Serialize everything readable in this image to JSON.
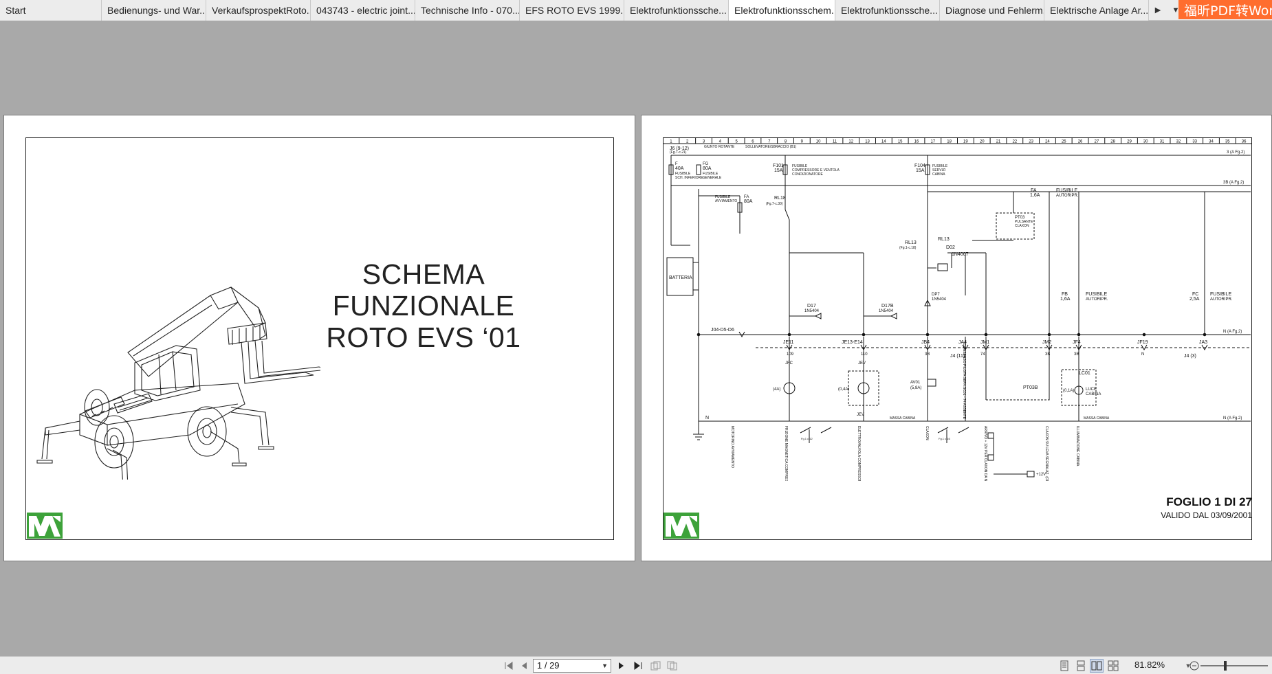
{
  "tabs": [
    {
      "label": "Start",
      "active": false
    },
    {
      "label": "Bedienungs- und War...",
      "active": false
    },
    {
      "label": "VerkaufsprospektRoto...",
      "active": false
    },
    {
      "label": "043743 - electric joint...",
      "active": false
    },
    {
      "label": "Technische Info - 070...",
      "active": false
    },
    {
      "label": "EFS ROTO EVS 1999....",
      "active": false
    },
    {
      "label": "Elektrofunktionssche...",
      "active": false
    },
    {
      "label": "Elektrofunktionsschem...",
      "active": true
    },
    {
      "label": "Elektrofunktionssche...",
      "active": false
    },
    {
      "label": "Diagnose und Fehlerm...",
      "active": false
    },
    {
      "label": "Elektrische Anlage Ar...",
      "active": false
    }
  ],
  "promo": {
    "label": "福昕PDF转Wor"
  },
  "page1": {
    "title_line1": "SCHEMA FUNZIONALE",
    "title_line2": "ROTO EVS ‘01"
  },
  "page2": {
    "sheet_label": "FOGLIO 1 DI 27",
    "valid_label": "VALIDO DAL 03/09/2001",
    "schematic": {
      "col_numbers": [
        "1",
        "2",
        "3",
        "4",
        "5",
        "6",
        "7",
        "8",
        "9",
        "10",
        "11",
        "12",
        "13",
        "14",
        "15",
        "16",
        "17",
        "18",
        "19",
        "20",
        "21",
        "22",
        "23",
        "24",
        "25",
        "26",
        "27",
        "28",
        "29",
        "30",
        "31",
        "32",
        "33",
        "34",
        "35",
        "36"
      ],
      "labels": {
        "j6": "J6 (9-12)",
        "fg7": "(Fg.7-c.21)",
        "giunto": "GIUNTO ROTANTE",
        "sollevato": "SOLLEVATORE/SBRACCIO (B1)",
        "f": "F",
        "f_a": "40A",
        "f_d1": "FUSIBILE",
        "f_d2": "SCH. INFERIORE",
        "fg": "FG",
        "fg_a": "80A",
        "fg_d1": "FUSIBILE",
        "fg_d2": "GENERALE",
        "fa_av": "FA",
        "fa_av_a": "80A",
        "fa_av_d1": "FUSIBILE",
        "fa_av_d2": "AVVIAMENTO",
        "f101": "F101",
        "f101_a": "15A",
        "f101_d1": "FUSIBILE",
        "f101_d2": "COMPRESSORE E VENTOLA",
        "f101_d3": "CONDIZIONATORE",
        "f104": "F104",
        "f104_a": "15A",
        "f104_d1": "FUSIBILE",
        "f104_d2": "SERVIZI",
        "f104_d3": "CABINA",
        "rl18": "RL18",
        "rl18_ref": "(Fg.7-c.30)",
        "rl13": "RL13",
        "rl13b": "RL13",
        "rl13_ref": "(Fg.1-c.18)",
        "d02": "D02",
        "d02_t": "1N4007",
        "d17": "D17",
        "d17_t": "1N5404",
        "d17b": "D17B",
        "d17b_t": "1N5404",
        "dp7": "DP7",
        "dp7_t": "1N5404",
        "fa": "FA",
        "fa_a": "1,6A",
        "fa_d1": "FUSIBILE",
        "fa_d2": "AUTORIPR.",
        "pt03": "PT03",
        "pt03_d1": "PULSANTE",
        "pt03_d2": "CLAXON",
        "fb": "FB",
        "fb_a": "1,6A",
        "fb_d1": "FUSIBILE",
        "fb_d2": "AUTORIPR.",
        "fc": "FC",
        "fc_a": "2,5A",
        "fc_d1": "FUSIBILE",
        "fc_d2": "AUTORIPR.",
        "batteria": "BATTERIA",
        "j4d5d6": "J04-D5-D6",
        "je11": "JE11",
        "je13": "JE13-E14",
        "jb4": "JB4",
        "ja4": "JA4",
        "jm1": "JM1",
        "jm2": "JM2",
        "jf4": "JF4",
        "jf19": "JF19",
        "ja3": "JA3",
        "w109": "109",
        "w110": "110",
        "w3b": "3B",
        "w74": "74",
        "w3b2": "3B",
        "w3b3": "3B",
        "wn": "N",
        "j4_11": "J4 (11)",
        "j4_3": "J4 (3)",
        "ref3": "3 (A Fg.2)",
        "ref3b": "3B (A Fg.2)",
        "refn": "N (A Fg.2)",
        "refn2": "N (A Fg.2)",
        "jfc": "JFC",
        "jev": "JEV",
        "jev2": "JEV",
        "c4a": "(4A)",
        "ev": "(0,4A)",
        "av01": "AV01",
        "av01_a": "(5,8A)",
        "pt03b": "PT03B",
        "lc01": "LC01",
        "lc01_a": "(0,1A)",
        "lc01_d1": "LUCE",
        "lc01_d2": "CABINA",
        "massa_cabina": "MASSA CABINA",
        "massa_cabina2": "MASSA CABINA",
        "n_gnd": "N",
        "v12": "+12V",
        "fg1c12": "Fg.1 c.12",
        "fg1c16": "Fg.1 c.16"
      },
      "rot_labels": {
        "motorino": "MOTORINO AVVIAMENTO",
        "frizione": "FRIZIONE MAGNETICA COMPRESSORE DEL CONDIZIONATORE (OPZIONALE 1/5)",
        "elettrovalvola": "ELETTROVALVOLA COMPRESSORE DEL CONDIZIONATORE (OPZIONALE 2/5)",
        "claxon": "CLAXON",
        "consenso": "CONSENSO PILOTA SERV.SC01 - 74 ASSENTE",
        "arrivo": "ARRIVO + 12V PER CLAXON DA NAVICELLA",
        "claxon_dx": "CLAXON SU LEVA SEGNALAZ. (OPZIONALE)",
        "illuminazione": "ILLUMINAZIONE CABINA"
      }
    }
  },
  "statusbar": {
    "page_display": "1 / 29",
    "zoom": "81.82%"
  },
  "colors": {
    "background": "#a9a9a9",
    "logo_green": "#3da23a",
    "promo": "#ff6d2e"
  }
}
